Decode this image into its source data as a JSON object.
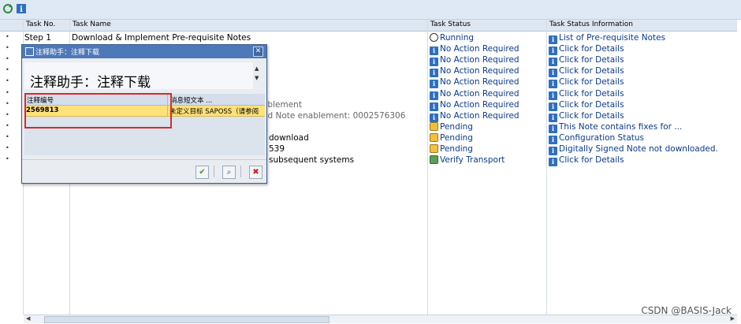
{
  "toolbar": {
    "icons": [
      "refresh-icon",
      "info-icon"
    ]
  },
  "columns": {
    "task_no": "Task No.",
    "task_name": "Task Name",
    "task_status": "Task Status",
    "task_status_info": "Task Status Information"
  },
  "rows": [
    {
      "mark": "•",
      "task_no": "Step 1",
      "task_name": "Download & Implement Pre-requisite Notes",
      "status": "Running",
      "status_icon": "clock-icon",
      "info": "List of Pre-requisite Notes"
    },
    {
      "mark": "•",
      "task_no": "",
      "task_name": "",
      "status": "No Action Required",
      "status_icon": "info-icon",
      "info": "Click for Details"
    },
    {
      "mark": "•",
      "task_no": "",
      "task_name": "",
      "status": "No Action Required",
      "status_icon": "info-icon",
      "info": "Click for Details"
    },
    {
      "mark": "•",
      "task_no": "",
      "task_name": "",
      "status": "No Action Required",
      "status_icon": "info-icon",
      "info": "Click for Details"
    },
    {
      "mark": "•",
      "task_no": "",
      "task_name": "",
      "status": "No Action Required",
      "status_icon": "info-icon",
      "info": "Click for Details"
    },
    {
      "mark": "•",
      "task_no": "",
      "task_name": "",
      "status": "No Action Required",
      "status_icon": "info-icon",
      "info": "Click for Details"
    },
    {
      "mark": "•",
      "task_no": "",
      "task_name": "ablement",
      "status": "No Action Required",
      "status_icon": "info-icon",
      "info": "Click for Details"
    },
    {
      "mark": "•",
      "task_no": "",
      "task_name": "ed Note enablement: 0002576306",
      "status": "No Action Required",
      "status_icon": "info-icon",
      "info": "Click for Details"
    },
    {
      "mark": "•",
      "task_no": "",
      "task_name": "",
      "status": "Pending",
      "status_icon": "pending-icon",
      "info": "This Note contains fixes for ..."
    },
    {
      "mark": "•",
      "task_no": "",
      "task_name": "download",
      "status": "Pending",
      "status_icon": "pending-icon",
      "info": "Configuration Status"
    },
    {
      "mark": "•",
      "task_no": "",
      "task_name": "539",
      "status": "Pending",
      "status_icon": "pending-icon",
      "info": "Digitally Signed Note not downloaded."
    },
    {
      "mark": "•",
      "task_no": "",
      "task_name": "subsequent systems",
      "status": "Verify Transport",
      "status_icon": "verify-icon",
      "info": "Click for Details"
    }
  ],
  "dialog": {
    "title": "注释助手：注释下载",
    "headline": "注释助手：注释下载",
    "col_note_no": "注释编号",
    "col_msg": "消息短文本 ...",
    "note_no": "2569813",
    "msg": "未定义目标 SAPOSS（请参阅",
    "buttons": {
      "ok": "✔",
      "find": "⌕",
      "cancel": "✖"
    }
  },
  "watermark": "CSDN @BASIS-Jack"
}
